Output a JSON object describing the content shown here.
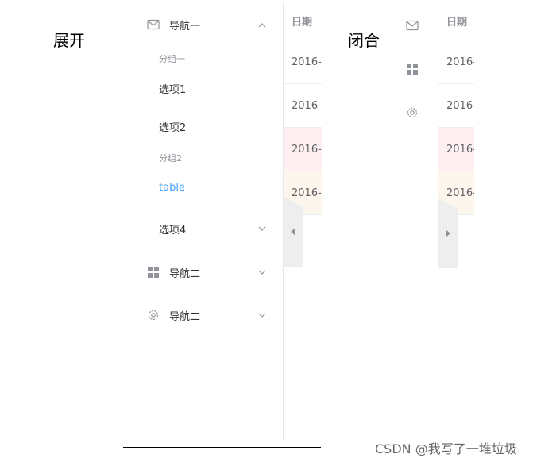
{
  "labels": {
    "expanded": "展开",
    "collapsed": "闭合"
  },
  "menu": {
    "nav1": {
      "label": "导航一"
    },
    "group1": "分组一",
    "option1": "选项1",
    "option2": "选项2",
    "group2": "分组2",
    "table": "table",
    "option4": "选项4",
    "nav2": {
      "label": "导航二"
    },
    "nav3": {
      "label": "导航二"
    }
  },
  "table": {
    "header": "日期",
    "rows": [
      "2016-0",
      "2016-0",
      "2016-0",
      "2016-0"
    ]
  },
  "table_closed": {
    "header": "日期",
    "rows": [
      "2016-",
      "2016-",
      "2016-",
      "2016-"
    ]
  },
  "colors": {
    "active": "#409eff",
    "danger_row": "#fef0f0",
    "warning_row": "#fdf6ec"
  },
  "icons": [
    "mail-icon",
    "grid-icon",
    "gear-icon",
    "chevron-up-icon",
    "chevron-down-icon"
  ],
  "watermark": "CSDN @我写了一堆垃圾"
}
